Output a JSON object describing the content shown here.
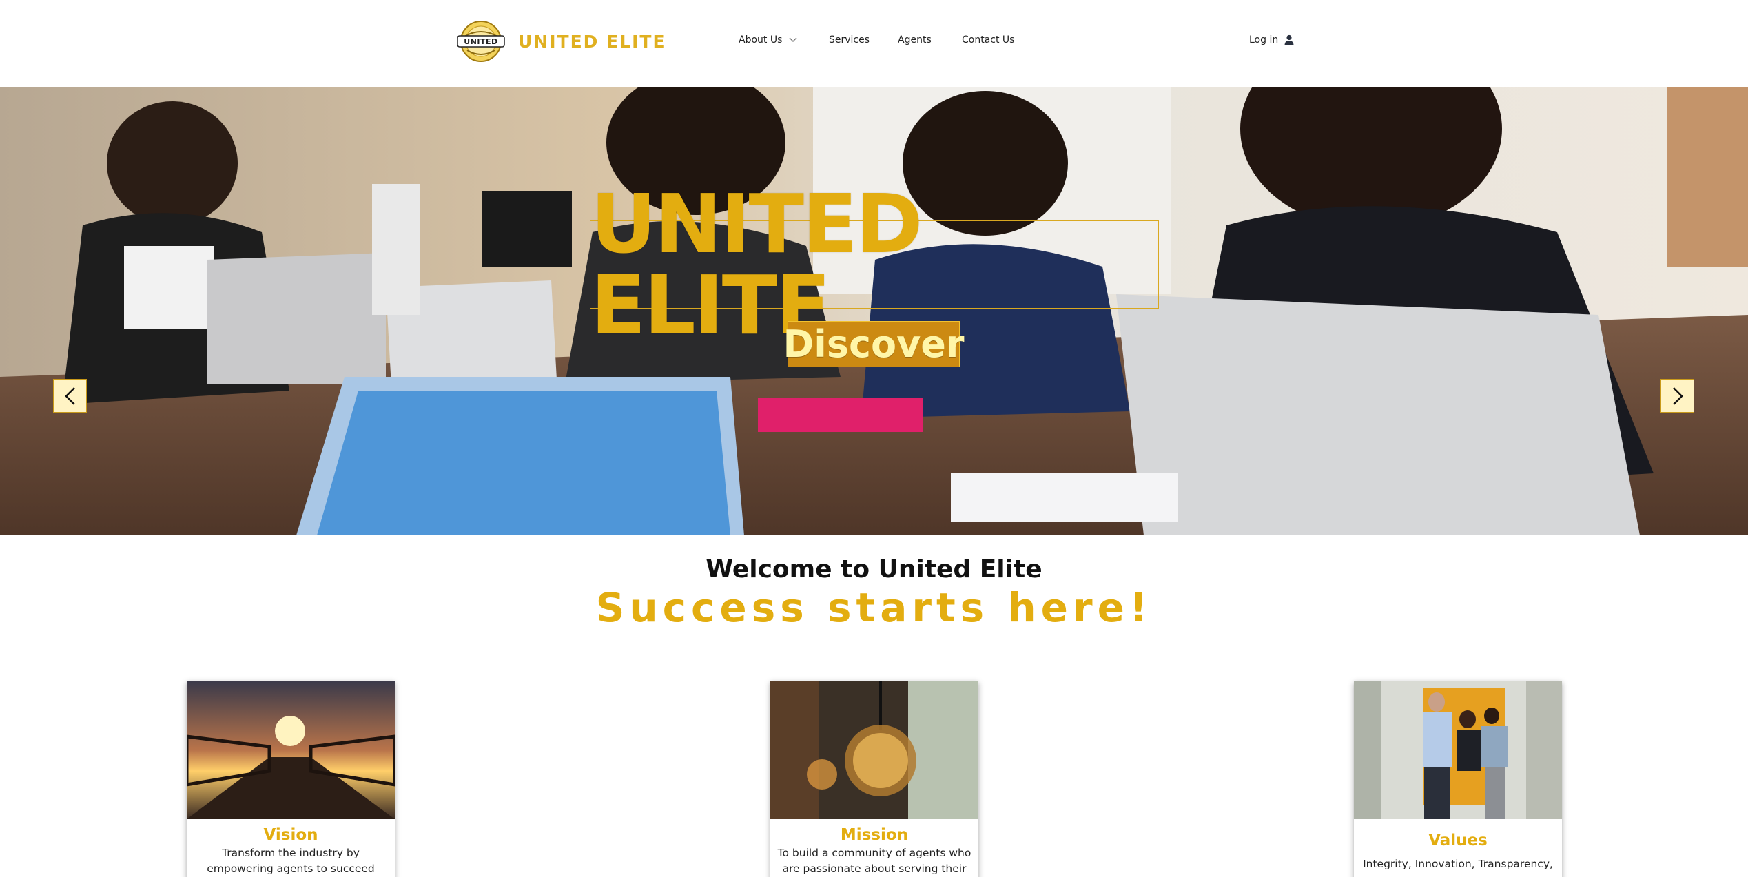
{
  "header": {
    "brand": "UNITED ELITE",
    "logo_text": "UNITED",
    "nav": [
      {
        "label": "About Us",
        "has_dropdown": true
      },
      {
        "label": "Services"
      },
      {
        "label": "Agents"
      },
      {
        "label": "Contact Us"
      }
    ],
    "login_label": "Log in"
  },
  "hero": {
    "title": "UNITED ELITE",
    "button_label": "Discover",
    "slides_count": 3,
    "active_slide": 1
  },
  "welcome": {
    "heading": "Welcome to United Elite",
    "tagline": "Success starts here!"
  },
  "cards": [
    {
      "title": "Vision",
      "text": "Transform the industry by empowering agents to succeed through innovation,"
    },
    {
      "title": "Mission",
      "text": "To build a community of agents who are passionate about serving their clients and"
    },
    {
      "title": "Values",
      "text": "Integrity, Innovation, Transparency,"
    }
  ],
  "colors": {
    "accent": "#e3ad10",
    "button_bg": "#cc8a12",
    "arrow_bg": "#fff3c4"
  }
}
